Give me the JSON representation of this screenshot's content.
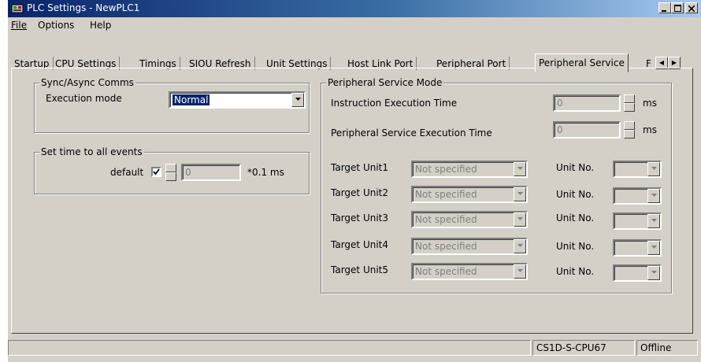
{
  "window": {
    "title": "PLC Settings - NewPLC1",
    "caption_buttons": [
      "minimize-icon",
      "maximize-icon",
      "close-icon"
    ]
  },
  "menu": [
    {
      "label": "File",
      "accel": "F"
    },
    {
      "label": "Options",
      "accel": "O"
    },
    {
      "label": "Help",
      "accel": "H"
    }
  ],
  "tabs": [
    {
      "label": "Startup"
    },
    {
      "label": "CPU Settings"
    },
    {
      "label": "Timings"
    },
    {
      "label": "SIOU Refresh"
    },
    {
      "label": "Unit Settings"
    },
    {
      "label": "Host Link Port"
    },
    {
      "label": "Peripheral Port"
    },
    {
      "label": "Peripheral Service",
      "active": true
    },
    {
      "label": "F"
    }
  ],
  "sync_async": {
    "group_title": "Sync/Async Comms",
    "exec_label": "Execution mode",
    "exec_value": "Normal"
  },
  "set_time": {
    "group_title": "Set time to all events",
    "default_label": "default",
    "default_checked": true,
    "value": "0",
    "unit": "*0.1 ms"
  },
  "peripheral": {
    "group_title": "Peripheral Service Mode",
    "instr_label": "Instruction Execution Time",
    "instr_value": "0",
    "instr_unit": "ms",
    "periph_label": "Peripheral Service Execution Time",
    "periph_value": "0",
    "periph_unit": "ms",
    "unit_no_label": "Unit No.",
    "targets": [
      {
        "label": "Target Unit1",
        "value": "Not specified",
        "unit_no": ""
      },
      {
        "label": "Target Unit2",
        "value": "Not specified",
        "unit_no": ""
      },
      {
        "label": "Target Unit3",
        "value": "Not specified",
        "unit_no": ""
      },
      {
        "label": "Target Unit4",
        "value": "Not specified",
        "unit_no": ""
      },
      {
        "label": "Target Unit5",
        "value": "Not specified",
        "unit_no": ""
      }
    ]
  },
  "status": {
    "model": "CS1D-S-CPU67",
    "mode": "Offline"
  }
}
